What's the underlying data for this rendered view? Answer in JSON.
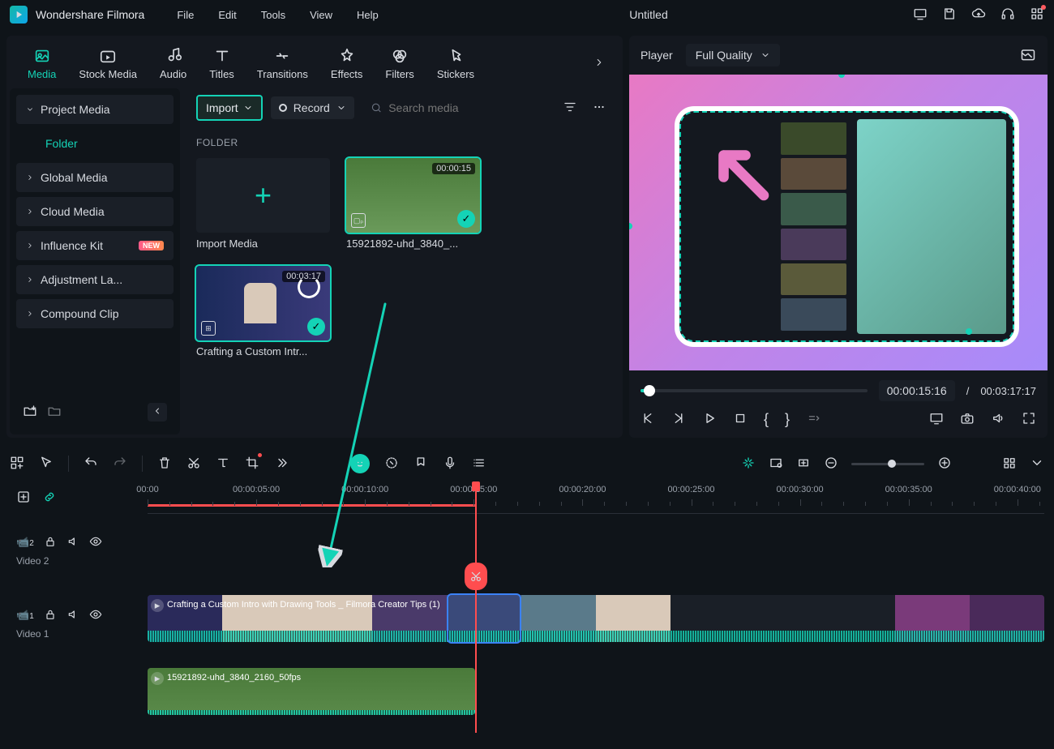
{
  "app": {
    "brand": "Wondershare Filmora",
    "doc": "Untitled"
  },
  "menu": [
    "File",
    "Edit",
    "Tools",
    "View",
    "Help"
  ],
  "tabs": [
    {
      "key": "media",
      "label": "Media"
    },
    {
      "key": "stock",
      "label": "Stock Media"
    },
    {
      "key": "audio",
      "label": "Audio"
    },
    {
      "key": "titles",
      "label": "Titles"
    },
    {
      "key": "transitions",
      "label": "Transitions"
    },
    {
      "key": "effects",
      "label": "Effects"
    },
    {
      "key": "filters",
      "label": "Filters"
    },
    {
      "key": "stickers",
      "label": "Stickers"
    }
  ],
  "sidebar": {
    "items": [
      {
        "label": "Project Media",
        "child": "Folder"
      },
      {
        "label": "Global Media"
      },
      {
        "label": "Cloud Media"
      },
      {
        "label": "Influence Kit",
        "badge": "NEW"
      },
      {
        "label": "Adjustment La..."
      },
      {
        "label": "Compound Clip"
      }
    ]
  },
  "toolbar": {
    "import": "Import",
    "record": "Record",
    "search_placeholder": "Search media"
  },
  "folder_label": "FOLDER",
  "media": [
    {
      "name": "Import Media",
      "import": true
    },
    {
      "name": "15921892-uhd_3840_...",
      "duration": "00:00:15",
      "selected": true,
      "check": true
    },
    {
      "name": "Crafting a Custom Intr...",
      "duration": "00:03:17",
      "check": true
    }
  ],
  "player": {
    "label": "Player",
    "quality": "Full Quality",
    "current": "00:00:15:16",
    "sep": "/",
    "total": "00:03:17:17"
  },
  "ruler": {
    "labels": [
      "00:00",
      "00:00:05:00",
      "00:00:10:00",
      "00:00:15:00",
      "00:00:20:00",
      "00:00:25:00",
      "00:00:30:00",
      "00:00:35:00",
      "00:00:40:00"
    ]
  },
  "tracks": [
    {
      "id": 2,
      "icon": "📹",
      "label": "Video 2",
      "clip_title": "Crafting a Custom Intro with Drawing Tools _ Filmora Creator Tips (1)"
    },
    {
      "id": 1,
      "icon": "📹",
      "label": "Video 1",
      "clip_title": "15921892-uhd_3840_2160_50fps"
    }
  ],
  "playhead_percent": 36.5,
  "range_percent": 36.5
}
